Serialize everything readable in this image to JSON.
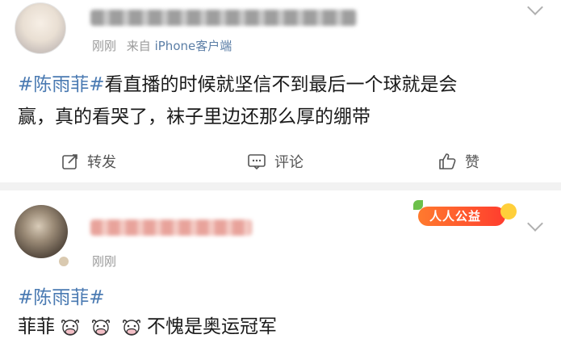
{
  "post1": {
    "meta_time": "刚刚",
    "meta_from": "来自",
    "meta_device": "iPhone客户端",
    "hashtag": "#陈雨菲#",
    "text_line1": "看直播的时候就坚信不到最后一个球就是会",
    "text_line2": "赢，真的看哭了，袜子里边还那么厚的绷带",
    "actions": {
      "repost": "转发",
      "comment": "评论",
      "like": "赞"
    }
  },
  "post2": {
    "badge": "人人公益",
    "meta_time": "刚刚",
    "hashtag": "#陈雨菲#",
    "text_prefix": "菲菲",
    "text_suffix": "不愧是奥运冠军",
    "emoji_count": 3
  },
  "colors": {
    "hashtag": "#4a7ab2",
    "meta": "#9a9a9a",
    "device": "#5b7ea6",
    "badge": "#ff5a2e"
  },
  "icons": [
    "chevron-down-icon",
    "repost-icon",
    "comment-icon",
    "like-icon",
    "cow-emoji-icon"
  ]
}
